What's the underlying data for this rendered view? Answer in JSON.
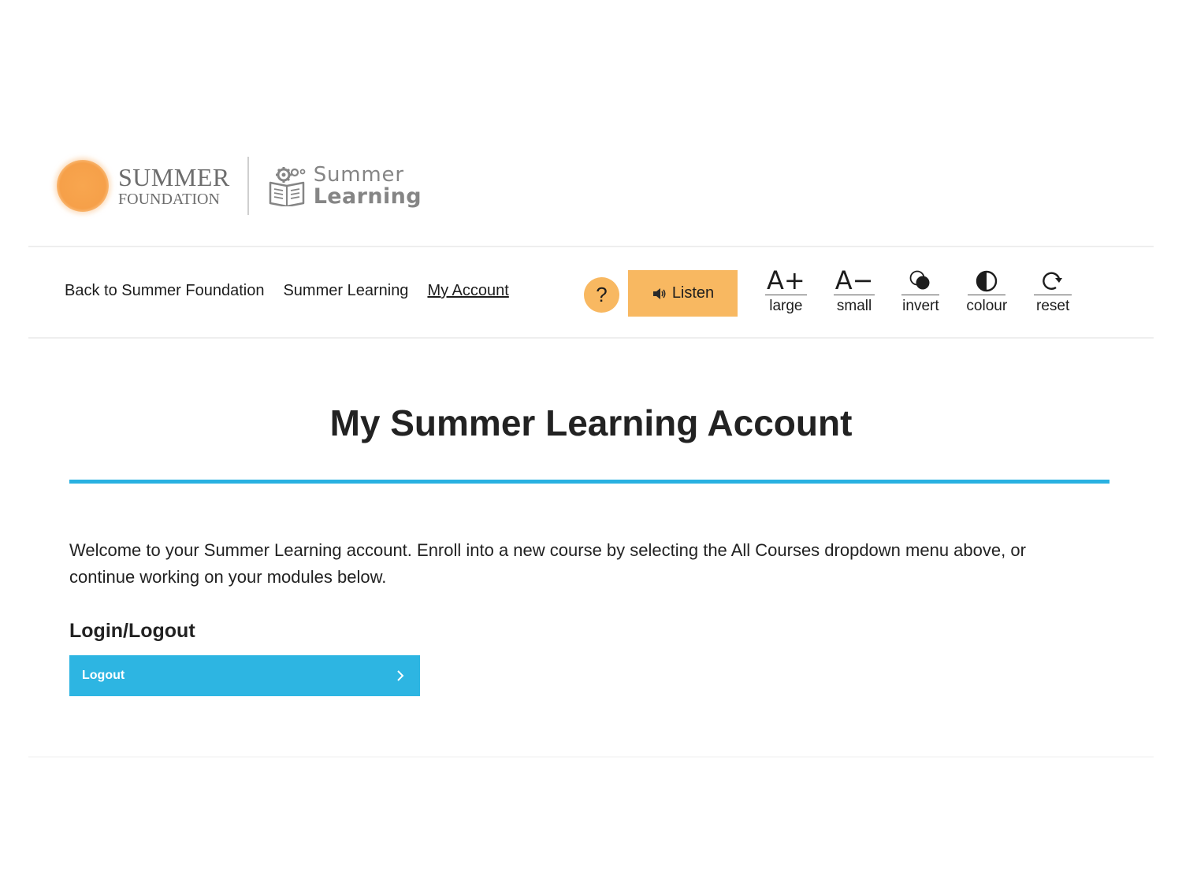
{
  "brand": {
    "foundation_line1": "SUMMER",
    "foundation_line2": "FOUNDATION",
    "learning_line1": "Summer",
    "learning_line2": "Learning"
  },
  "nav": {
    "links": [
      {
        "label": "Back to Summer Foundation"
      },
      {
        "label": "Summer Learning"
      },
      {
        "label": "My Account",
        "active": true
      }
    ],
    "help_label": "?",
    "listen_label": "Listen",
    "listen_icon": "speaker-icon"
  },
  "tools": [
    {
      "glyph": "A+",
      "label": "large"
    },
    {
      "glyph": "A−",
      "label": "small"
    },
    {
      "icon": "invert-icon",
      "label": "invert"
    },
    {
      "icon": "contrast-icon",
      "label": "colour"
    },
    {
      "icon": "refresh-icon",
      "label": "reset"
    }
  ],
  "main": {
    "title": "My Summer Learning Account",
    "welcome": "Welcome to your Summer Learning account. Enroll into a new course by selecting the All Courses dropdown menu above, or continue working on your modules below.",
    "section_heading": "Login/Logout",
    "logout_label": "Logout"
  },
  "colors": {
    "accent_orange": "#f8b861",
    "accent_blue": "#2db5e2",
    "text": "#222222"
  }
}
